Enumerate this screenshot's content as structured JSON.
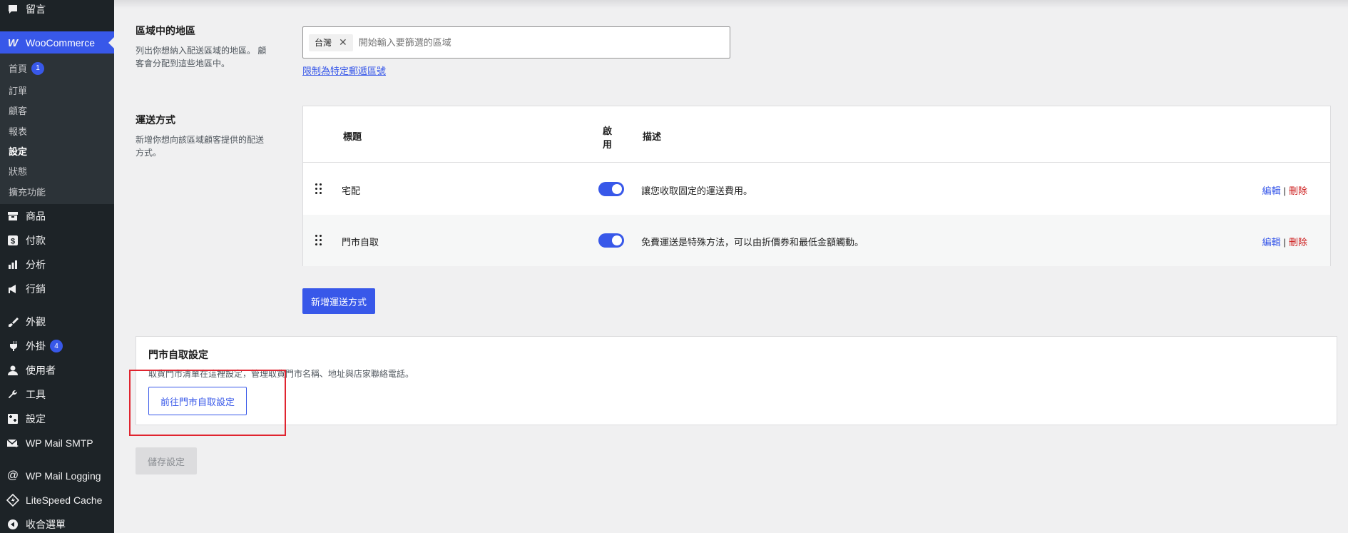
{
  "sidebar": {
    "comments": {
      "label": "留言",
      "icon": "comment-icon"
    },
    "woocommerce": {
      "label": "WooCommerce",
      "logo": "W",
      "icon": "woo-logo-icon"
    },
    "woo_submenu": [
      {
        "label": "首頁",
        "count": "1"
      },
      {
        "label": "訂單"
      },
      {
        "label": "顧客"
      },
      {
        "label": "報表"
      },
      {
        "label": "設定",
        "current": true
      },
      {
        "label": "狀態"
      },
      {
        "label": "擴充功能"
      }
    ],
    "items": [
      {
        "label": "商品",
        "icon": "archive-icon"
      },
      {
        "label": "付款",
        "icon": "dollar-icon"
      },
      {
        "label": "分析",
        "icon": "chart-icon"
      },
      {
        "label": "行銷",
        "icon": "megaphone-icon"
      },
      {
        "label": "外觀",
        "icon": "brush-icon"
      },
      {
        "label": "外掛",
        "icon": "plugin-icon",
        "count": "4"
      },
      {
        "label": "使用者",
        "icon": "user-icon"
      },
      {
        "label": "工具",
        "icon": "wrench-icon"
      },
      {
        "label": "設定",
        "icon": "settings-icon"
      },
      {
        "label": "WP Mail SMTP",
        "icon": "mail-icon"
      },
      {
        "label": "WP Mail Logging",
        "icon": "at-icon"
      },
      {
        "label": "LiteSpeed Cache",
        "icon": "litespeed-icon"
      },
      {
        "label": "收合選單",
        "icon": "collapse-icon"
      }
    ]
  },
  "zone_regions": {
    "title": "區域中的地區",
    "description": "列出你想納入配送區域的地區。 顧客會分配到這些地區中。",
    "selected_tag": "台灣",
    "placeholder": "開始輸入要篩選的區域",
    "postcode_link": "限制為特定郵遞區號"
  },
  "shipping_methods": {
    "title": "運送方式",
    "description": "新增你想向該區域顧客提供的配送方式。",
    "columns": {
      "title": "標題",
      "enabled_line1": "啟",
      "enabled_line2": "用",
      "description": "描述"
    },
    "rows": [
      {
        "title": "宅配",
        "enabled": true,
        "description": "讓您收取固定的運送費用。",
        "edit": "編輯",
        "separator": "|",
        "delete": "刪除"
      },
      {
        "title": "門市自取",
        "enabled": true,
        "description": "免費運送是特殊方法，可以由折價券和最低金額觸動。",
        "edit": "編輯",
        "separator": "|",
        "delete": "刪除"
      }
    ],
    "add_button": "新增運送方式"
  },
  "pickup_settings": {
    "title": "門市自取設定",
    "description": "取貨門市清單在這裡設定，管理取貨門市名稱、地址與店家聯絡電話。",
    "button": "前往門市自取設定"
  },
  "save_button": "儲存設定",
  "colors": {
    "accent": "#3858e9",
    "sidebar": "#1d2327",
    "delete": "#cc1818",
    "highlight": "#e0242f"
  }
}
